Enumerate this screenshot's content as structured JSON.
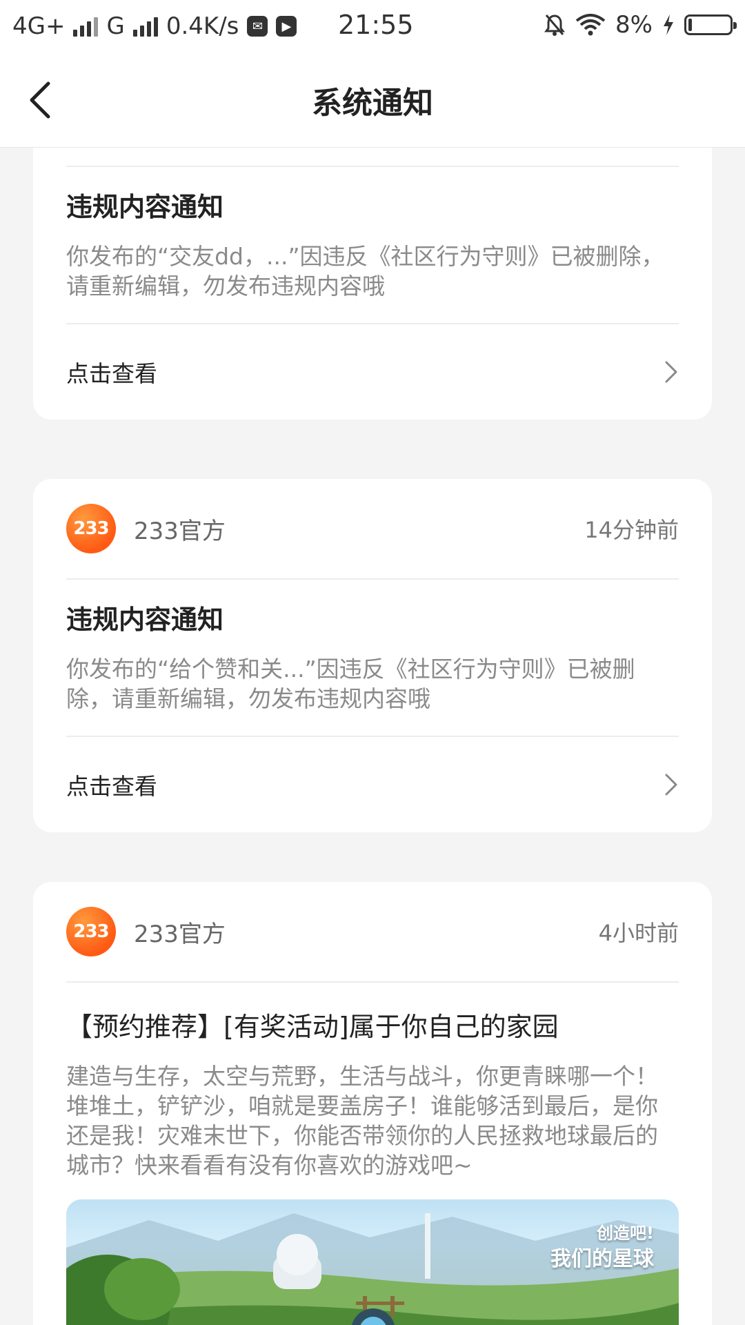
{
  "status_bar": {
    "network1": "4G+",
    "network2": "G",
    "speed": "0.4K/s",
    "time": "21:55",
    "battery": "8%",
    "battery_level": 0.08
  },
  "header": {
    "title": "系统通知"
  },
  "cards": [
    {
      "title": "违规内容通知",
      "description": "你发布的“交友dd，...”因违反《社区行为守则》已被删除，请重新编辑，勿发布违规内容哦",
      "footer": "点击查看"
    },
    {
      "logo": "233",
      "publisher": "233官方",
      "time": "14分钟前",
      "title": "违规内容通知",
      "description": "你发布的“给个赞和关...”因违反《社区行为守则》已被删除，请重新编辑，勿发布违规内容哦",
      "footer": "点击查看"
    },
    {
      "logo": "233",
      "publisher": "233官方",
      "time": "4小时前",
      "title": "【预约推荐】[有奖活动]属于你自己的家园",
      "description": "建造与生存，太空与荒野，生活与战斗，你更青睐哪一个！堆堆土，铲铲沙，咱就是要盖房子！谁能够活到最后，是你还是我！灾难末世下，你能否带领你的人民拯救地球最后的城市？快来看看有没有你喜欢的游戏吧~",
      "image_text_line1": "创造吧!",
      "image_text_line2": "我们的星球"
    }
  ]
}
